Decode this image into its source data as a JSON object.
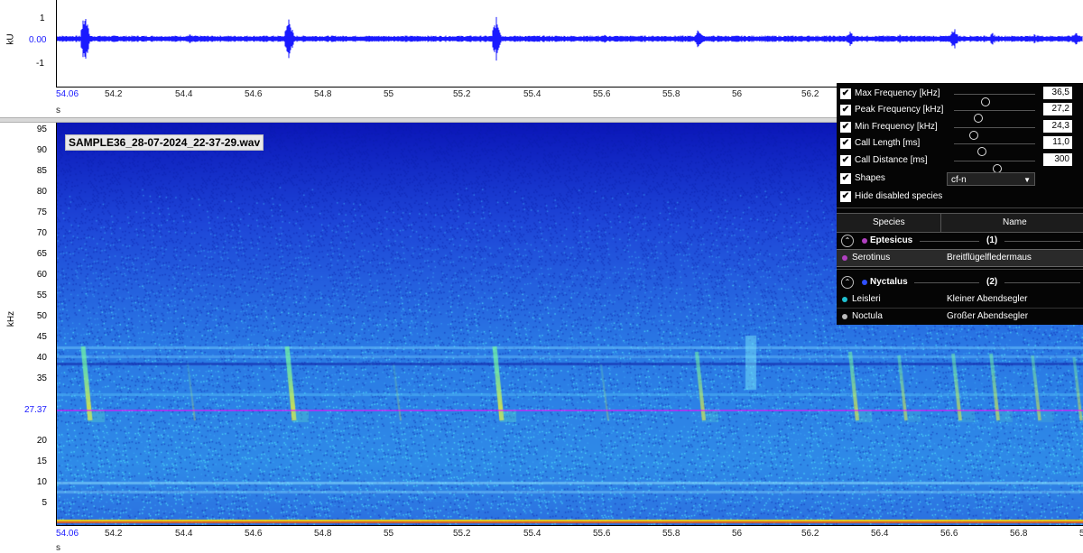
{
  "waveform": {
    "y_axis_title": "kU",
    "y_ticks": [
      "1",
      "0.00",
      "-1"
    ],
    "x_unit": "s"
  },
  "spectrogram": {
    "y_axis_title": "kHz",
    "y_ticks": [
      "95",
      "90",
      "85",
      "80",
      "75",
      "70",
      "65",
      "60",
      "55",
      "50",
      "45",
      "40",
      "35",
      "27.37",
      "20",
      "15",
      "10",
      "5"
    ],
    "marker_frequency": "27.37",
    "x_unit": "s",
    "filename": "SAMPLE36_28-07-2024_22-37-29.wav"
  },
  "time_axis": {
    "labels": [
      "54.06",
      "54.2",
      "54.4",
      "54.6",
      "54.8",
      "55",
      "55.2",
      "55.4",
      "55.6",
      "55.8",
      "56",
      "56.2",
      "56.4",
      "56.6",
      "56.8",
      "5"
    ]
  },
  "panel": {
    "filters": [
      {
        "label": "Max Frequency [kHz]",
        "value": "36,5",
        "checked": true,
        "level": 0.35
      },
      {
        "label": "Peak Frequency [kHz]",
        "value": "27,2",
        "checked": true,
        "level": 0.25
      },
      {
        "label": "Min Frequency [kHz]",
        "value": "24,3",
        "checked": true,
        "level": 0.2
      },
      {
        "label": "Call Length [ms]",
        "value": "11,0",
        "checked": true,
        "level": 0.3
      },
      {
        "label": "Call Distance [ms]",
        "value": "300",
        "checked": true,
        "level": 0.5
      }
    ],
    "shapes_label": "Shapes",
    "shapes_value": "cf-n",
    "hide_label": "Hide disabled species",
    "col_species": "Species",
    "col_name": "Name",
    "groups": [
      {
        "name": "Eptesicus",
        "count": "(1)",
        "color": "#b040c0",
        "species": [
          {
            "species": "Serotinus",
            "common": "Breitflügelfledermaus",
            "color": "#b040c0"
          }
        ]
      },
      {
        "name": "Nyctalus",
        "count": "(2)",
        "color": "#3050ff",
        "species": [
          {
            "species": "Leisleri",
            "common": "Kleiner Abendsegler",
            "color": "#20c0d0"
          },
          {
            "species": "Noctula",
            "common": "Großer Abendsegler",
            "color": "#bbbbbb"
          }
        ]
      }
    ],
    "checkmark": "✔",
    "collapse_icon": "⌃"
  },
  "colors": {
    "waveform": "#1a1aff",
    "marker_line": "#ff00ff",
    "spec_bg": "#1f46d0"
  }
}
